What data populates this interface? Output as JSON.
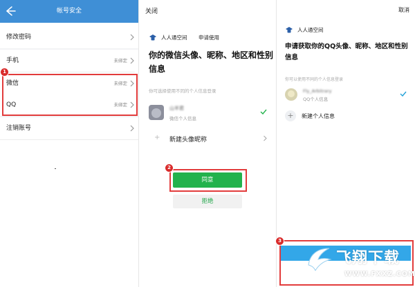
{
  "panel1": {
    "title": "帐号安全",
    "rows": [
      {
        "label": "修改密码",
        "status": ""
      },
      {
        "label": "手机",
        "status": "未绑定"
      },
      {
        "label": "微信",
        "status": "未绑定"
      },
      {
        "label": "QQ",
        "status": "未绑定"
      },
      {
        "label": "注销账号",
        "status": ""
      }
    ],
    "badge": "1",
    "header_color": "#3f8fd6"
  },
  "panel2": {
    "close": "关闭",
    "app_name": "人人通空间",
    "request": "申请使用",
    "heading": "你的微信头像、昵称、地区和性别信息",
    "hint": "你可选择使用不同的个人信息登录",
    "profile_name": "山羊君",
    "profile_sub": "微信个人信息",
    "new_profile": "新建头像昵称",
    "agree": "同意",
    "reject": "拒绝",
    "badge": "2",
    "agree_color": "#22b24c"
  },
  "panel3": {
    "cancel": "取消",
    "app_name": "人人通空间",
    "heading": "申请获取你的QQ头像、昵称、地区和性别信息",
    "hint": "你可以使用不同的个人信息登录",
    "profile_name": "Fly_Arbitrary",
    "profile_sub": "QQ个人信息",
    "new_profile": "新建个人信息",
    "badge": "3",
    "bar_color": "#33a7e8"
  },
  "watermark": {
    "title": "飞翔下载",
    "url": "WWW.FXXZ.COM"
  },
  "accent_red": "#e23b3b"
}
